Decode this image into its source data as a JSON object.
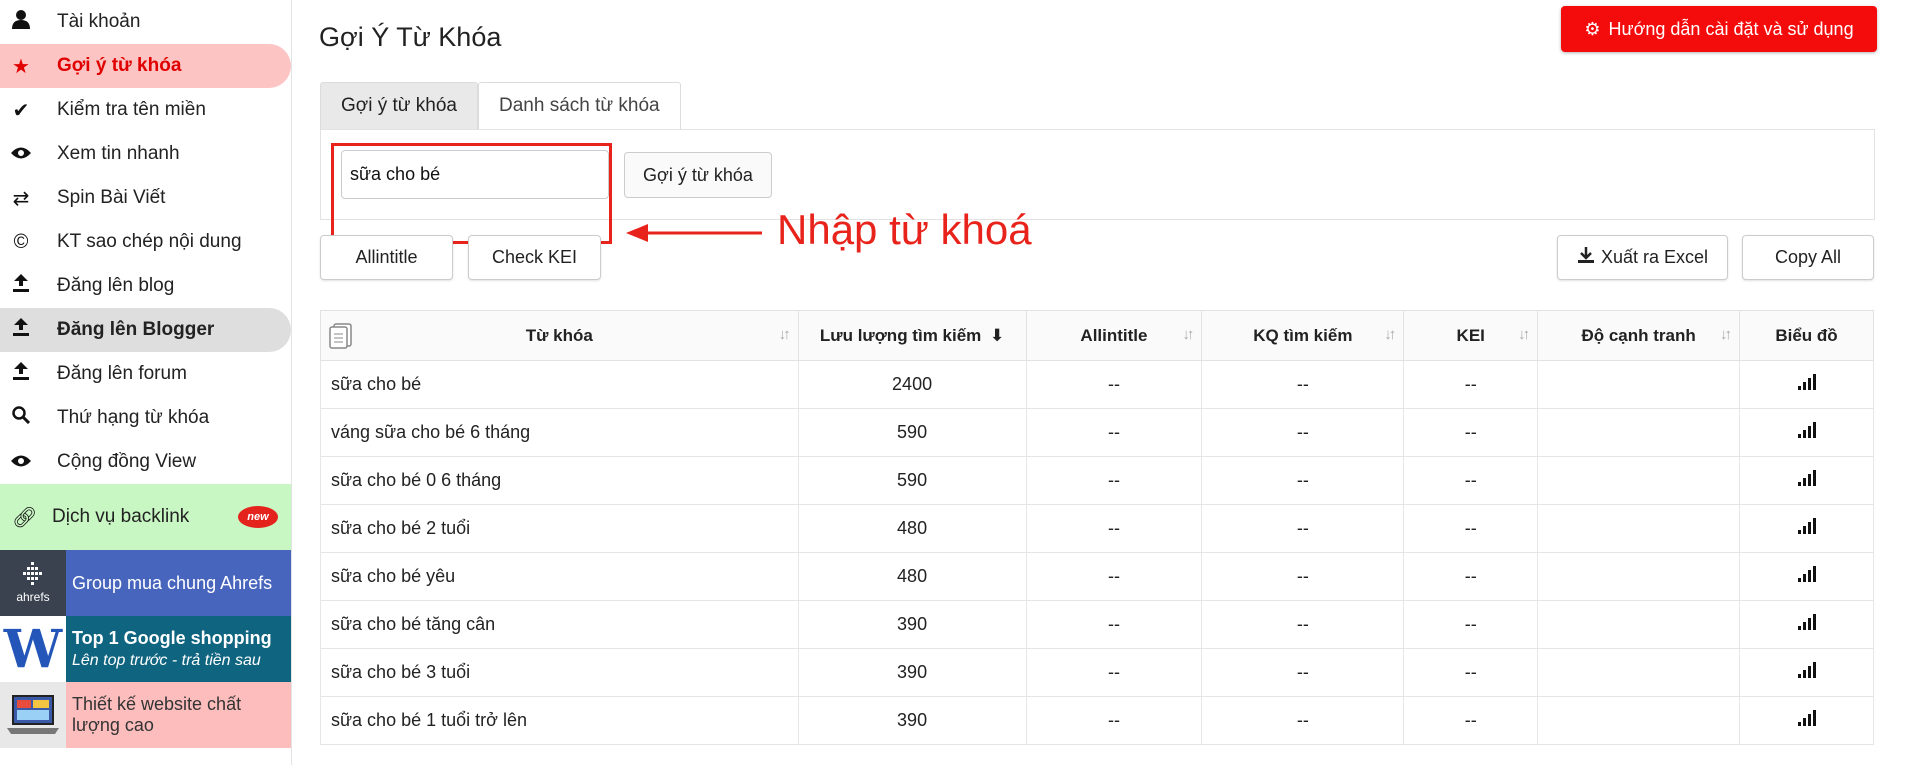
{
  "sidebar": {
    "items": [
      {
        "label": "Tài khoản",
        "icon": "user-icon"
      },
      {
        "label": "Gợi ý từ khóa",
        "icon": "star-icon"
      },
      {
        "label": "Kiểm tra tên miền",
        "icon": "check-icon"
      },
      {
        "label": "Xem tin nhanh",
        "icon": "eye-icon"
      },
      {
        "label": "Spin Bài Viết",
        "icon": "shuffle-icon"
      },
      {
        "label": "KT sao chép nội dung",
        "icon": "copyright-icon"
      },
      {
        "label": "Đăng lên blog",
        "icon": "upload-icon"
      },
      {
        "label": "Đăng lên Blogger",
        "icon": "upload-icon"
      },
      {
        "label": "Đăng lên forum",
        "icon": "upload-icon"
      },
      {
        "label": "Thứ hạng từ khóa",
        "icon": "search-icon"
      },
      {
        "label": "Cộng đồng View",
        "icon": "eye-icon"
      }
    ],
    "backlink": {
      "label": "Dịch vụ backlink",
      "badge": "new"
    },
    "promos": [
      {
        "text": "Group mua chung Ahrefs",
        "logo_text": "ahrefs"
      },
      {
        "title": "Top 1 Google shopping",
        "subtitle": "Lên top trước - trả tiền sau",
        "logo_text": "W"
      },
      {
        "text": "Thiết kế website chất lượng cao"
      }
    ]
  },
  "header": {
    "title": "Gợi Ý Từ Khóa",
    "guide_button": "Hướng dẫn cài đặt và sử dụng"
  },
  "tabs": [
    {
      "label": "Gợi ý từ khóa",
      "active": true
    },
    {
      "label": "Danh sách từ khóa",
      "active": false
    }
  ],
  "search": {
    "value": "sữa cho bé",
    "button": "Gợi ý từ khóa"
  },
  "annotation": "Nhập từ khoá",
  "actions": {
    "allintitle": "Allintitle",
    "check_kei": "Check KEI",
    "export_excel": "Xuất ra Excel",
    "copy_all": "Copy All"
  },
  "table": {
    "columns": [
      "Từ khóa",
      "Lưu lượng tìm kiếm",
      "Allintitle",
      "KQ tìm kiếm",
      "KEI",
      "Độ cạnh tranh",
      "Biểu đồ"
    ],
    "rows": [
      {
        "keyword": "sữa cho bé",
        "volume": "2400",
        "allintitle": "--",
        "results": "--",
        "kei": "--",
        "competition": ""
      },
      {
        "keyword": "váng sữa cho bé 6 tháng",
        "volume": "590",
        "allintitle": "--",
        "results": "--",
        "kei": "--",
        "competition": ""
      },
      {
        "keyword": "sữa cho bé 0 6 tháng",
        "volume": "590",
        "allintitle": "--",
        "results": "--",
        "kei": "--",
        "competition": ""
      },
      {
        "keyword": "sữa cho bé 2 tuổi",
        "volume": "480",
        "allintitle": "--",
        "results": "--",
        "kei": "--",
        "competition": ""
      },
      {
        "keyword": "sữa cho bé yêu",
        "volume": "480",
        "allintitle": "--",
        "results": "--",
        "kei": "--",
        "competition": ""
      },
      {
        "keyword": "sữa cho bé tăng cân",
        "volume": "390",
        "allintitle": "--",
        "results": "--",
        "kei": "--",
        "competition": ""
      },
      {
        "keyword": "sữa cho bé 3 tuổi",
        "volume": "390",
        "allintitle": "--",
        "results": "--",
        "kei": "--",
        "competition": ""
      },
      {
        "keyword": "sữa cho bé 1 tuổi trở lên",
        "volume": "390",
        "allintitle": "--",
        "results": "--",
        "kei": "--",
        "competition": ""
      }
    ]
  },
  "colors": {
    "accent_red": "#f40c0c",
    "active_nav_bg": "#fdc4c4",
    "backlink_bg": "#c9f7c4",
    "annotation_red": "#e8231b"
  }
}
